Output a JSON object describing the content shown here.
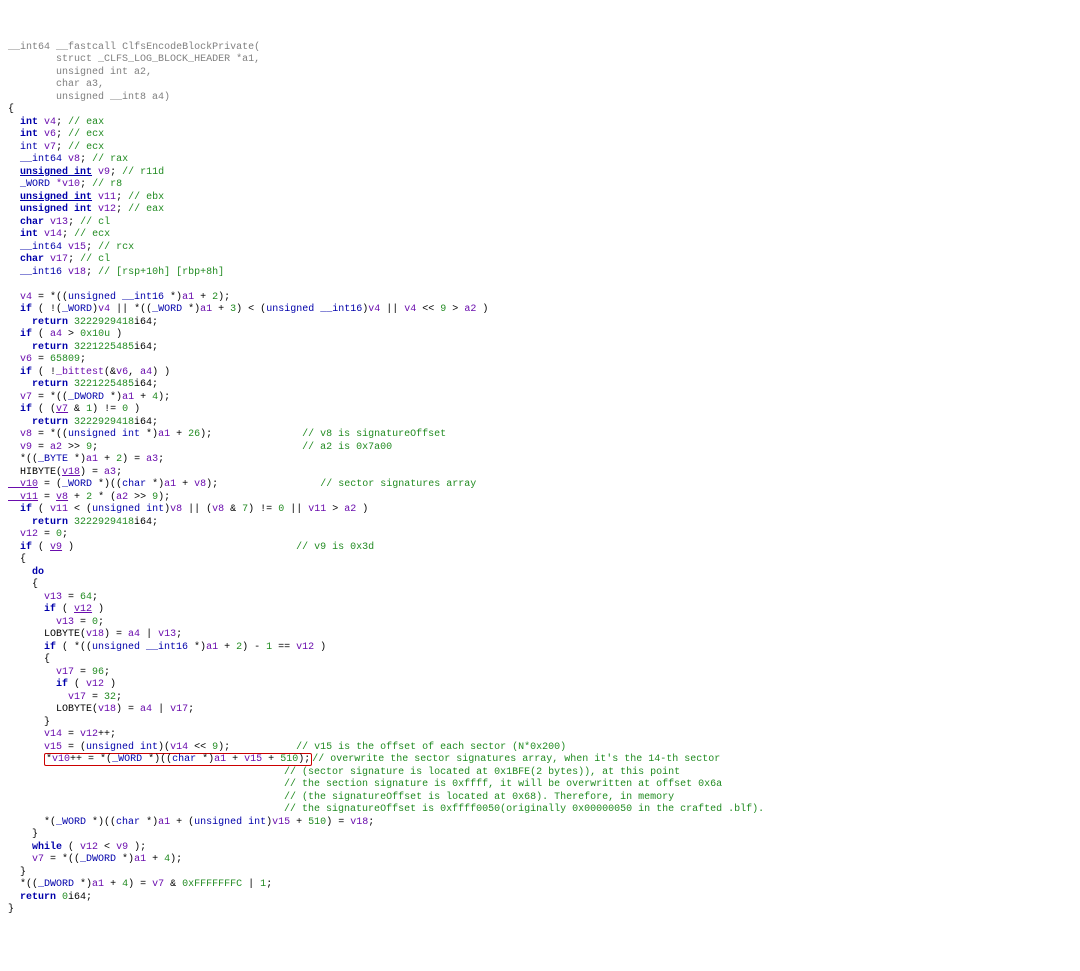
{
  "header": {
    "ret": "__int64",
    "cc": "__fastcall",
    "fn": "ClfsEncodeBlockPrivate",
    "open": "(",
    "p1_kw": "struct",
    "p1_type": "_CLFS_LOG_BLOCK_HEADER",
    "p1_name": "*a1,",
    "p2_type": "unsigned int",
    "p2_name": "a2,",
    "p3_type": "char",
    "p3_name": "a3,",
    "p4_type": "unsigned __int8",
    "p4_name": "a4)"
  },
  "decl": {
    "v4": {
      "t": "int",
      "n": "v4",
      "c": "// eax"
    },
    "v6": {
      "t": "int",
      "n": "v6",
      "c": "// ecx"
    },
    "v7": {
      "t": "int",
      "n": "v7",
      "c": "// ecx"
    },
    "v8": {
      "t": "__int64",
      "n": "v8",
      "c": "// rax"
    },
    "v9": {
      "t": "unsigned int",
      "n": "v9",
      "c": "// r11d"
    },
    "v10": {
      "t": "_WORD",
      "n": "*v10",
      "c": "// r8"
    },
    "v11": {
      "t": "unsigned int",
      "n": "v11",
      "c": "// ebx"
    },
    "v12": {
      "t": "unsigned int",
      "n": "v12",
      "c": "// eax"
    },
    "v13": {
      "t": "char",
      "n": "v13",
      "c": "// cl"
    },
    "v14": {
      "t": "int",
      "n": "v14",
      "c": "// ecx"
    },
    "v15": {
      "t": "__int64",
      "n": "v15",
      "c": "// rcx"
    },
    "v17": {
      "t": "char",
      "n": "v17",
      "c": "// cl"
    },
    "v18": {
      "t": "__int16",
      "n": "v18",
      "c": "// [rsp+10h] [rbp+8h]"
    }
  },
  "body": {
    "l1_a": "  v4",
    "l1_b": " = *((",
    "l1_c": "unsigned __int16",
    "l1_d": " *)",
    "l1_e": "a1",
    "l1_f": " + ",
    "l1_g": "2",
    "l1_h": ");",
    "l2_a": "  if",
    "l2_b": " ( !(",
    "l2_c": "_WORD",
    "l2_d": ")",
    "l2_e": "v4",
    "l2_f": " || *((",
    "l2_g": "_WORD",
    "l2_h": " *)",
    "l2_i": "a1",
    "l2_j": " + ",
    "l2_k": "3",
    "l2_l": ") < (",
    "l2_m": "unsigned __int16",
    "l2_n": ")",
    "l2_o": "v4",
    "l2_p": " || ",
    "l2_q": "v4",
    "l2_r": " << ",
    "l2_s": "9",
    "l2_t": " > ",
    "l2_u": "a2",
    "l2_v": " )",
    "l3_a": "    return",
    "l3_b": " ",
    "l3_c": "3222929418",
    "l3_d": "i64;",
    "l4_a": "  if",
    "l4_b": " ( ",
    "l4_c": "a4",
    "l4_d": " > ",
    "l4_e": "0x10u",
    "l4_f": " )",
    "l5_a": "    return",
    "l5_b": " ",
    "l5_c": "3221225485",
    "l5_d": "i64;",
    "l6_a": "  v6",
    "l6_b": " = ",
    "l6_c": "65809",
    "l6_d": ";",
    "l7_a": "  if",
    "l7_b": " ( !",
    "l7_c": "_bittest",
    "l7_d": "(&",
    "l7_e": "v6",
    "l7_f": ", ",
    "l7_g": "a4",
    "l7_h": ") )",
    "l8_a": "    return",
    "l8_b": " ",
    "l8_c": "3221225485",
    "l8_d": "i64;",
    "l9_a": "  v7",
    "l9_b": " = *((",
    "l9_c": "_DWORD",
    "l9_d": " *)",
    "l9_e": "a1",
    "l9_f": " + ",
    "l9_g": "4",
    "l9_h": ");",
    "l10_a": "  if",
    "l10_b": " ( (",
    "l10_c": "v7",
    "l10_d": " & ",
    "l10_e": "1",
    "l10_f": ") != ",
    "l10_g": "0",
    "l10_h": " )",
    "l11_a": "    return",
    "l11_b": " ",
    "l11_c": "3222929418",
    "l11_d": "i64;",
    "l12_a": "  v8",
    "l12_b": " = *((",
    "l12_c": "unsigned int",
    "l12_d": " *)",
    "l12_e": "a1",
    "l12_f": " + ",
    "l12_g": "26",
    "l12_h": ");",
    "l12_c1": "// v8 is signatureOffset",
    "l13_a": "  v9",
    "l13_b": " = ",
    "l13_c": "a2",
    "l13_d": " >> ",
    "l13_e": "9",
    "l13_f": ";",
    "l13_c1": "// a2 is 0x7a00",
    "l14_a": "  *((",
    "l14_b": "_BYTE",
    "l14_c": " *)",
    "l14_d": "a1",
    "l14_e": " + ",
    "l14_f": "2",
    "l14_g": ") = ",
    "l14_h": "a3",
    "l14_i": ";",
    "l15_a": "  HIBYTE(",
    "l15_b": "v18",
    "l15_c": ") = ",
    "l15_d": "a3",
    "l15_e": ";",
    "l16_a": "  v10",
    "l16_b": " = (",
    "l16_c": "_WORD",
    "l16_d": " *)((",
    "l16_e": "char",
    "l16_f": " *)",
    "l16_g": "a1",
    "l16_h": " + ",
    "l16_i": "v8",
    "l16_j": ");",
    "l16_c1": "// sector signatures array",
    "l17_a": "  v11",
    "l17_b": " = ",
    "l17_c": "v8",
    "l17_d": " + ",
    "l17_e": "2",
    "l17_f": " * (",
    "l17_g": "a2",
    "l17_h": " >> ",
    "l17_i": "9",
    "l17_j": ");",
    "l18_a": "  if",
    "l18_b": " ( ",
    "l18_c": "v11",
    "l18_d": " < (",
    "l18_e": "unsigned int",
    "l18_f": ")",
    "l18_g": "v8",
    "l18_h": " || (",
    "l18_i": "v8",
    "l18_j": " & ",
    "l18_k": "7",
    "l18_l": ") != ",
    "l18_m": "0",
    "l18_n": " || ",
    "l18_o": "v11",
    "l18_p": " > ",
    "l18_q": "a2",
    "l18_r": " )",
    "l19_a": "    return",
    "l19_b": " ",
    "l19_c": "3222929418",
    "l19_d": "i64;",
    "l20_a": "  v12",
    "l20_b": " = ",
    "l20_c": "0",
    "l20_d": ";",
    "l21_a": "  if",
    "l21_b": " ( ",
    "l21_c": "v9",
    "l21_d": " )",
    "l21_c1": "// v9 is 0x3d",
    "l22_a": "  {",
    "l23_a": "    do",
    "l24_a": "    {",
    "l25_a": "      v13",
    "l25_b": " = ",
    "l25_c": "64",
    "l25_d": ";",
    "l26_a": "      if",
    "l26_b": " ( ",
    "l26_c": "v12",
    "l26_d": " )",
    "l27_a": "        v13",
    "l27_b": " = ",
    "l27_c": "0",
    "l27_d": ";",
    "l28_a": "      LOBYTE(",
    "l28_b": "v18",
    "l28_c": ") = ",
    "l28_d": "a4",
    "l28_e": " | ",
    "l28_f": "v13",
    "l28_g": ";",
    "l29_a": "      if",
    "l29_b": " ( *((",
    "l29_c": "unsigned __int16",
    "l29_d": " *)",
    "l29_e": "a1",
    "l29_f": " + ",
    "l29_g": "2",
    "l29_h": ") - ",
    "l29_i": "1",
    "l29_j": " == ",
    "l29_k": "v12",
    "l29_l": " )",
    "l30_a": "      {",
    "l31_a": "        v17",
    "l31_b": " = ",
    "l31_c": "96",
    "l31_d": ";",
    "l32_a": "        if",
    "l32_b": " ( ",
    "l32_c": "v12",
    "l32_d": " )",
    "l33_a": "          v17",
    "l33_b": " = ",
    "l33_c": "32",
    "l33_d": ";",
    "l34_a": "        LOBYTE(",
    "l34_b": "v18",
    "l34_c": ") = ",
    "l34_d": "a4",
    "l34_e": " | ",
    "l34_f": "v17",
    "l34_g": ";",
    "l35_a": "      }",
    "l36_a": "      v14",
    "l36_b": " = ",
    "l36_c": "v12",
    "l36_d": "++;",
    "l37_a": "      v15",
    "l37_b": " = (",
    "l37_c": "unsigned int",
    "l37_d": ")(",
    "l37_e": "v14",
    "l37_f": " << ",
    "l37_g": "9",
    "l37_h": ");",
    "l37_c1": "// v15 is the offset of each sector (N*0x200)",
    "hl_a": "*",
    "hl_b": "v10",
    "hl_c": "++ = *(",
    "hl_d": "_WORD",
    "hl_e": " *)((",
    "hl_f": "char",
    "hl_g": " *)",
    "hl_h": "a1",
    "hl_i": " + ",
    "hl_j": "v15",
    "hl_k": " + ",
    "hl_l": "510",
    "hl_m": ");",
    "c1": "// overwrite the sector signatures array, when it's the 14-th sector",
    "c2": "// (sector signature is located at 0x1BFE(2 bytes)), at this point",
    "c3": "// the section signature is 0xffff, it will be overwritten at offset 0x6a",
    "c4": "// (the signatureOffset is located at 0x68). Therefore, in memory",
    "c5": "// the signatureOffset is 0xffff0050(originally 0x00000050 in the crafted .blf).",
    "l39_a": "      *(",
    "l39_b": "_WORD",
    "l39_c": " *)((",
    "l39_d": "char",
    "l39_e": " *)",
    "l39_f": "a1",
    "l39_g": " + (",
    "l39_h": "unsigned int",
    "l39_i": ")",
    "l39_j": "v15",
    "l39_k": " + ",
    "l39_l": "510",
    "l39_m": ") = ",
    "l39_n": "v18",
    "l39_o": ";",
    "l40_a": "    }",
    "l41_a": "    while",
    "l41_b": " ( ",
    "l41_c": "v12",
    "l41_d": " < ",
    "l41_e": "v9",
    "l41_f": " );",
    "l42_a": "    v7",
    "l42_b": " = *((",
    "l42_c": "_DWORD",
    "l42_d": " *)",
    "l42_e": "a1",
    "l42_f": " + ",
    "l42_g": "4",
    "l42_h": ");",
    "l43_a": "  }",
    "l44_a": "  *((",
    "l44_b": "_DWORD",
    "l44_c": " *)",
    "l44_d": "a1",
    "l44_e": " + ",
    "l44_f": "4",
    "l44_g": ") = ",
    "l44_h": "v7",
    "l44_i": " & ",
    "l44_j": "0xFFFFFFFC",
    "l44_k": " | ",
    "l44_l": "1",
    "l44_m": ";",
    "l45_a": "  return",
    "l45_b": " ",
    "l45_c": "0",
    "l45_d": "i64;",
    "l46_a": "}"
  }
}
